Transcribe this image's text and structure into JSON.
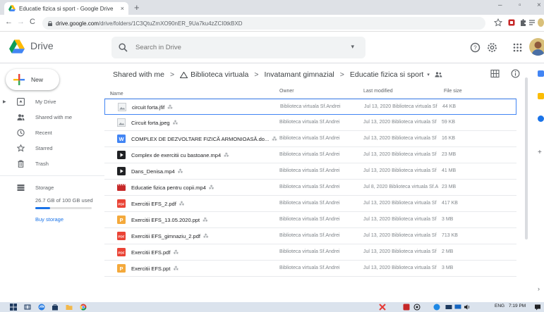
{
  "browser": {
    "tab_title": "Educatie fizica si sport - Google Drive",
    "tab_close": "×",
    "new_tab": "+",
    "window_controls": [
      "–",
      "▫",
      "×"
    ],
    "nav": {
      "back": "←",
      "forward": "→",
      "reload": "C"
    },
    "url_host": "drive.google.com",
    "url_path": "/drive/folders/1C3QtuZmXO90nER_9Ua7ku4zZCI0tkBXD"
  },
  "header": {
    "app_name": "Drive",
    "search_placeholder": "Search in Drive",
    "search_options": "▾"
  },
  "sidebar": {
    "new_label": "New",
    "items": [
      {
        "label": "My Drive",
        "icon": "my-drive-icon",
        "has_caret": true
      },
      {
        "label": "Shared with me",
        "icon": "shared-with-me-icon"
      },
      {
        "label": "Recent",
        "icon": "recent-icon"
      },
      {
        "label": "Starred",
        "icon": "star-icon"
      },
      {
        "label": "Trash",
        "icon": "trash-icon"
      }
    ],
    "storage_label": "Storage",
    "storage_used": "26.7 GB of 100 GB used",
    "storage_fraction": 0.267,
    "buy_storage": "Buy storage"
  },
  "breadcrumb": {
    "items": [
      "Shared with me",
      "Biblioteca virtuala",
      "Invatamant gimnazial",
      "Educatie fizica si sport"
    ],
    "separator": ">",
    "dropdown": "▾"
  },
  "list": {
    "headers": {
      "name": "Name",
      "sort": "↑",
      "owner": "Owner",
      "modified": "Last modified",
      "size": "File size"
    },
    "shared_glyph": "⁂",
    "rows": [
      {
        "name": "circuit forta.jfif",
        "icon": "image-file-icon",
        "owner": "Biblioteca virtuala Sf.Andrei",
        "modified": "Jul 13, 2020",
        "modified_by": "Biblioteca virtuala Sf",
        "size": "44 KB",
        "selected": true
      },
      {
        "name": "Circuit forta.jpeg",
        "icon": "image-file-icon",
        "owner": "Biblioteca virtuala Sf.Andrei",
        "modified": "Jul 13, 2020",
        "modified_by": "Biblioteca virtuala Sf",
        "size": "59 KB"
      },
      {
        "name": "COMPLEX DE DEZVOLTARE FIZICĂ ARMONIOASĂ.do...",
        "icon": "word-doc-icon",
        "owner": "Biblioteca virtuala Sf.Andrei",
        "modified": "Jul 13, 2020",
        "modified_by": "Biblioteca virtuala Sf",
        "size": "16 KB"
      },
      {
        "name": "Complex de exercitii cu bastoane.mp4",
        "icon": "video-file-icon",
        "owner": "Biblioteca virtuala Sf.Andrei",
        "modified": "Jul 13, 2020",
        "modified_by": "Biblioteca virtuala Sf",
        "size": "23 MB"
      },
      {
        "name": "Dans_Denisa.mp4",
        "icon": "video-file-icon",
        "owner": "Biblioteca virtuala Sf.Andrei",
        "modified": "Jul 13, 2020",
        "modified_by": "Biblioteca virtuala Sf",
        "size": "41 MB"
      },
      {
        "name": "Educatie fizica pentru copii.mp4",
        "icon": "video-file-red-icon",
        "owner": "Biblioteca virtuala Sf.Andrei",
        "modified": "Jul 8, 2020",
        "modified_by": "Biblioteca virtuala Sf.A",
        "size": "23 MB"
      },
      {
        "name": "Exercitii EFS_2.pdf",
        "icon": "pdf-file-icon",
        "owner": "Biblioteca virtuala Sf.Andrei",
        "modified": "Jul 13, 2020",
        "modified_by": "Biblioteca virtuala Sf",
        "size": "417 KB"
      },
      {
        "name": "Exercitii EFS_13.05.2020.ppt",
        "icon": "ppt-file-icon",
        "owner": "Biblioteca virtuala Sf.Andrei",
        "modified": "Jul 13, 2020",
        "modified_by": "Biblioteca virtuala Sf",
        "size": "3 MB"
      },
      {
        "name": "Exercitii EFS_gimnaziu_2.pdf",
        "icon": "pdf-file-icon",
        "owner": "Biblioteca virtuala Sf.Andrei",
        "modified": "Jul 13, 2020",
        "modified_by": "Biblioteca virtuala Sf",
        "size": "713 KB"
      },
      {
        "name": "Exercitii EFS.pdf",
        "icon": "pdf-file-icon",
        "owner": "Biblioteca virtuala Sf.Andrei",
        "modified": "Jul 13, 2020",
        "modified_by": "Biblioteca virtuala Sf",
        "size": "2 MB"
      },
      {
        "name": "Exercitii EFS.ppt",
        "icon": "ppt-file-icon",
        "owner": "Biblioteca virtuala Sf.Andrei",
        "modified": "Jul 13, 2020",
        "modified_by": "Biblioteca virtuala Sf",
        "size": "3 MB"
      }
    ]
  },
  "taskbar": {
    "tray_lang": "ENG",
    "clock": "7:19 PM"
  },
  "colors": {
    "accent": "#1a73e8",
    "pdf_red": "#ea4335",
    "word_blue": "#4285f4",
    "ppt_orange": "#f4a93b"
  }
}
